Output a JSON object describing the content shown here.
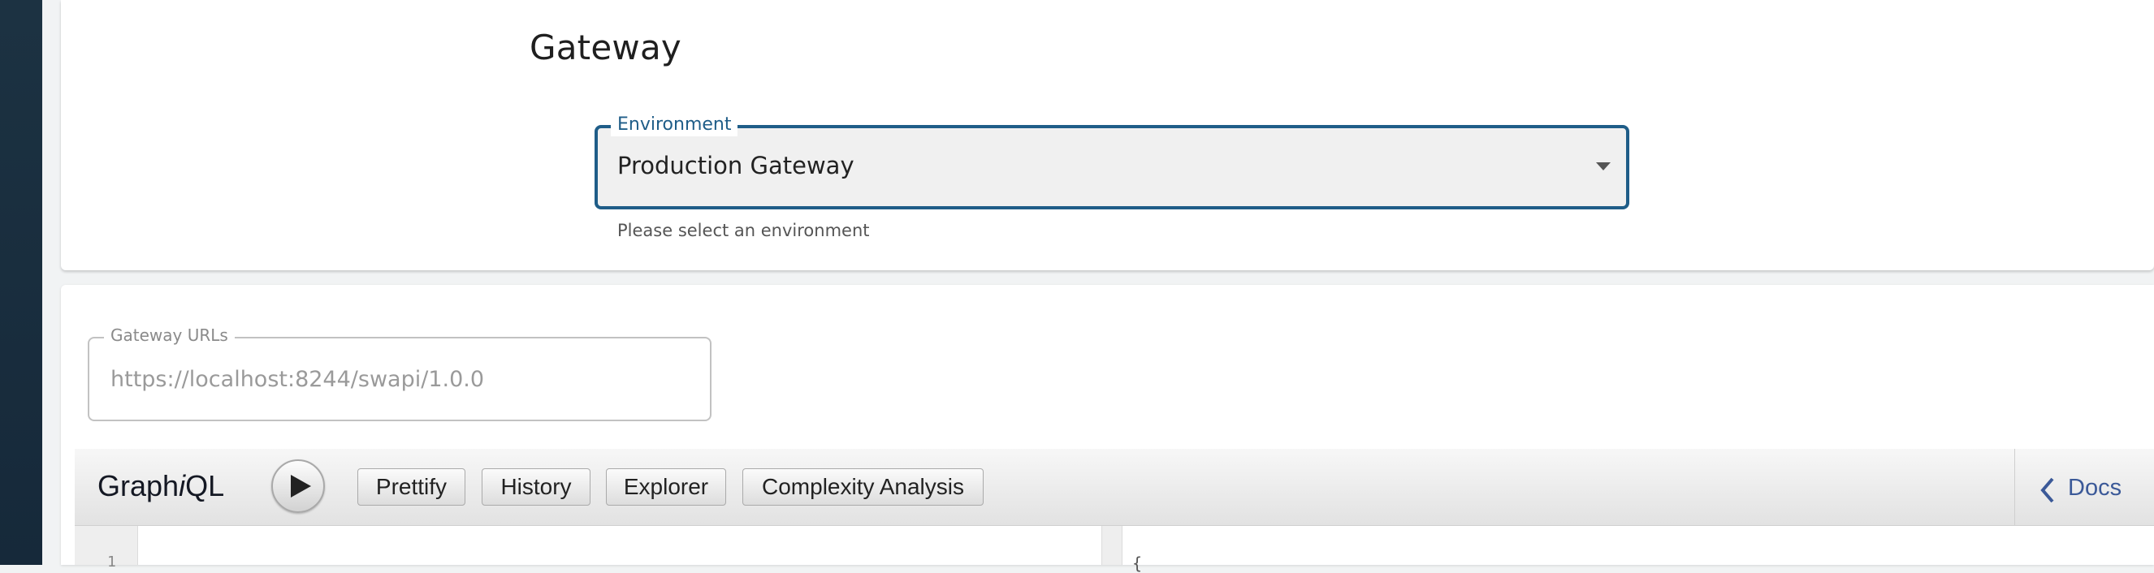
{
  "gateway_section": {
    "title": "Gateway",
    "environment": {
      "legend": "Environment",
      "value": "Production Gateway",
      "helper": "Please select an environment"
    }
  },
  "gateway_urls": {
    "legend": "Gateway URLs",
    "value": "https://localhost:8244/swapi/1.0.0"
  },
  "graphiql": {
    "title_pre": "Graph",
    "title_italic": "i",
    "title_post": "QL",
    "buttons": {
      "prettify": "Prettify",
      "history": "History",
      "explorer": "Explorer",
      "complexity": "Complexity Analysis"
    },
    "docs_label": "Docs",
    "editor": {
      "gutter_text": "1",
      "result_text": "{"
    }
  },
  "colors": {
    "accent": "#1f5d88",
    "sidebar": "#1c3242",
    "docs_link": "#3b5998"
  },
  "icons": {
    "run": "play-icon",
    "docs": "chevron-left-icon",
    "select": "caret-down-icon"
  }
}
